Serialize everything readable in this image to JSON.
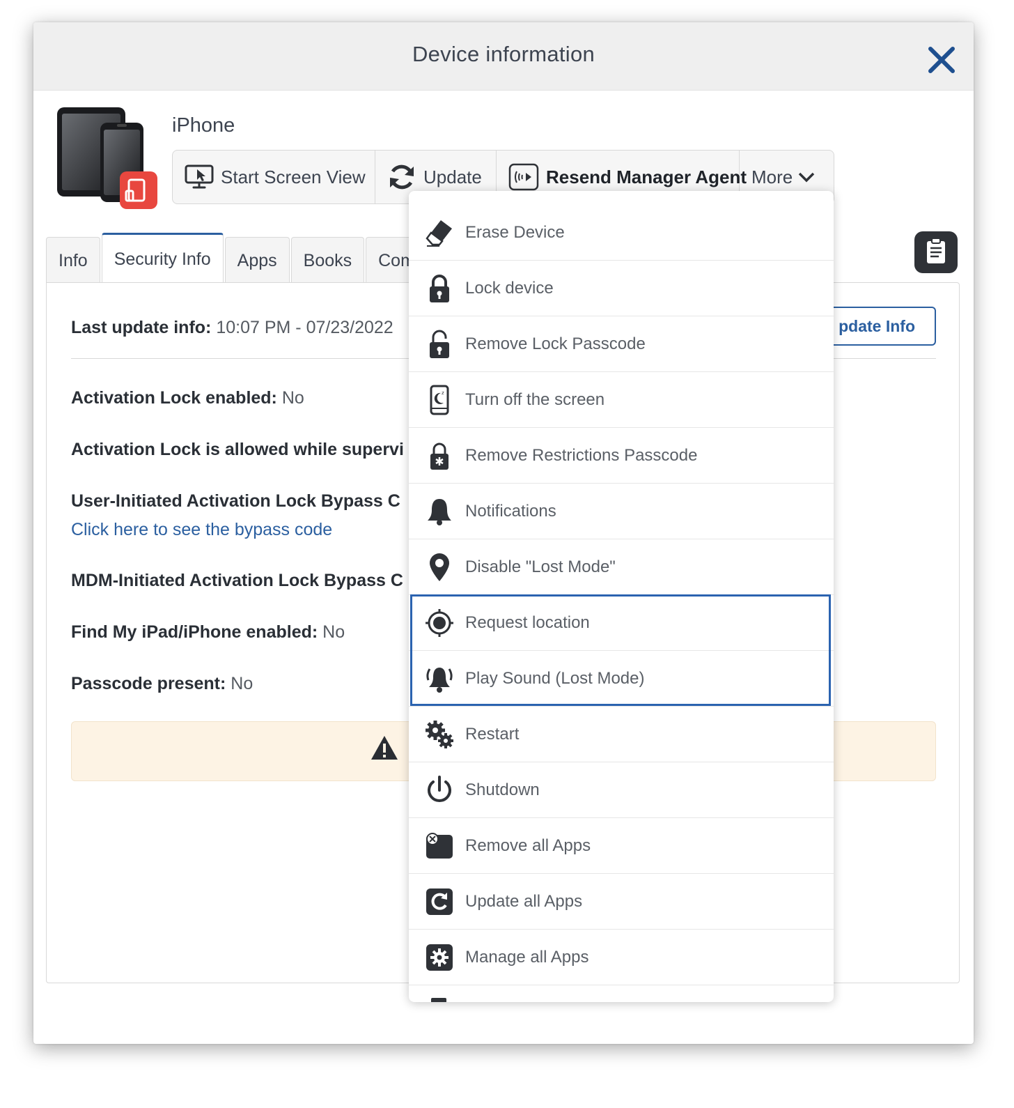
{
  "modal": {
    "title": "Device information"
  },
  "device": {
    "name": "iPhone"
  },
  "toolbar": {
    "start_screen_view": "Start Screen View",
    "update": "Update",
    "resend_manager_agent": "Resend Manager Agent",
    "more": "More"
  },
  "tabs": [
    {
      "label": "Info"
    },
    {
      "label": "Security Info"
    },
    {
      "label": "Apps"
    },
    {
      "label": "Books"
    },
    {
      "label": "Comr"
    }
  ],
  "security": {
    "last_update_label": "Last update info:",
    "last_update_value": "10:07 PM - 07/23/2022",
    "update_info_button": "pdate Info",
    "activation_lock_label": "Activation Lock enabled:",
    "activation_lock_value": "No",
    "activation_allowed_label": "Activation Lock is allowed while supervi",
    "user_bypass_label": "User-Initiated Activation Lock Bypass C",
    "bypass_link": "Click here to see the bypass code",
    "mdm_bypass_label": "MDM-Initiated Activation Lock Bypass C",
    "find_my_label": "Find My iPad/iPhone enabled:",
    "find_my_value": "No",
    "passcode_label": "Passcode present:",
    "passcode_value": "No"
  },
  "menu": {
    "items": [
      {
        "label": "Erase Device",
        "icon": "eraser-icon"
      },
      {
        "label": "Lock device",
        "icon": "lock-icon"
      },
      {
        "label": "Remove Lock Passcode",
        "icon": "unlock-icon"
      },
      {
        "label": "Turn off the screen",
        "icon": "phone-sleep-icon"
      },
      {
        "label": "Remove Restrictions Passcode",
        "icon": "restrictions-lock-icon"
      },
      {
        "label": "Notifications",
        "icon": "bell-icon"
      },
      {
        "label": "Disable \"Lost Mode\"",
        "icon": "map-pin-icon"
      },
      {
        "label": "Request location",
        "icon": "target-icon"
      },
      {
        "label": "Play Sound (Lost Mode)",
        "icon": "ringing-bell-icon"
      },
      {
        "label": "Restart",
        "icon": "gears-icon"
      },
      {
        "label": "Shutdown",
        "icon": "power-icon"
      },
      {
        "label": "Remove all Apps",
        "icon": "remove-apps-icon"
      },
      {
        "label": "Update all Apps",
        "icon": "update-apps-icon"
      },
      {
        "label": "Manage all Apps",
        "icon": "manage-apps-icon"
      }
    ]
  },
  "colors": {
    "accent": "#2b5fa0",
    "highlight": "#2b63b0",
    "warning_bg": "#fdf3e4",
    "badge": "#e8473f"
  }
}
